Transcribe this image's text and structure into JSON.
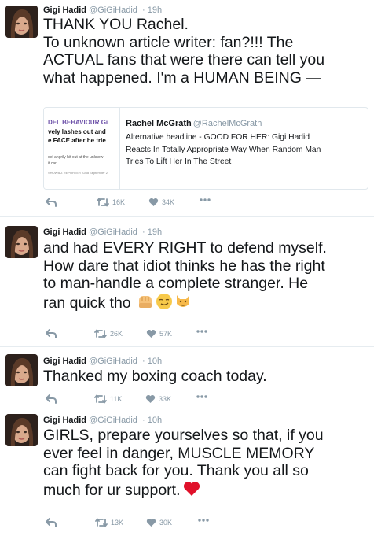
{
  "tweets": [
    {
      "name": "Gigi Hadid",
      "handle": "@GiGiHadid",
      "time": "· 19h",
      "text_lines": [
        "THANK YOU Rachel.",
        "To unknown article writer: fan?!!! The",
        "ACTUAL fans that were there can tell you",
        "what happened. I'm a HUMAN BEING —"
      ],
      "retweets": "16K",
      "likes": "34K"
    },
    {
      "name": "Gigi Hadid",
      "handle": "@GiGiHadid",
      "time": "· 19h",
      "text_lines": [
        "and had EVERY RIGHT to defend myself.",
        "How dare that idiot thinks he has the right",
        "to man-handle a complete stranger. He",
        "ran quick tho"
      ],
      "emojis": [
        "fist-emoji",
        "smirk-emoji",
        "cat-emoji"
      ],
      "retweets": "26K",
      "likes": "57K"
    },
    {
      "name": "Gigi Hadid",
      "handle": "@GiGiHadid",
      "time": "· 10h",
      "text_lines": [
        "Thanked my boxing coach today."
      ],
      "retweets": "11K",
      "likes": "33K"
    },
    {
      "name": "Gigi Hadid",
      "handle": "@GiGiHadid",
      "time": "· 10h",
      "text_lines": [
        "GIRLS, prepare yourselves so that, if you",
        "ever feel in danger, MUSCLE MEMORY",
        "can fight back for you. Thank you all so",
        "much for ur support."
      ],
      "emojis": [
        "heart-emoji"
      ],
      "retweets": "13K",
      "likes": "30K"
    }
  ],
  "quoted": {
    "name": "Rachel McGrath",
    "handle": "@RachelMcGrath",
    "text_lines": [
      "Alternative headline - GOOD FOR HER: Gigi Hadid",
      "Reacts In Totally Appropriate Way When Random Man",
      "Tries To Lift Her In The Street"
    ],
    "thumb_lines": [
      "DEL BEHAVIOUR Gi",
      "vely lashes out and",
      "e FACE after he trie",
      "del angrily hit out at the unknow",
      "it car",
      "SHOWBIZ REPORTER   22nd September 2"
    ]
  },
  "colors": {
    "action_gray": "#8899a6",
    "text": "#14171a",
    "heart_red": "#e0112a"
  }
}
